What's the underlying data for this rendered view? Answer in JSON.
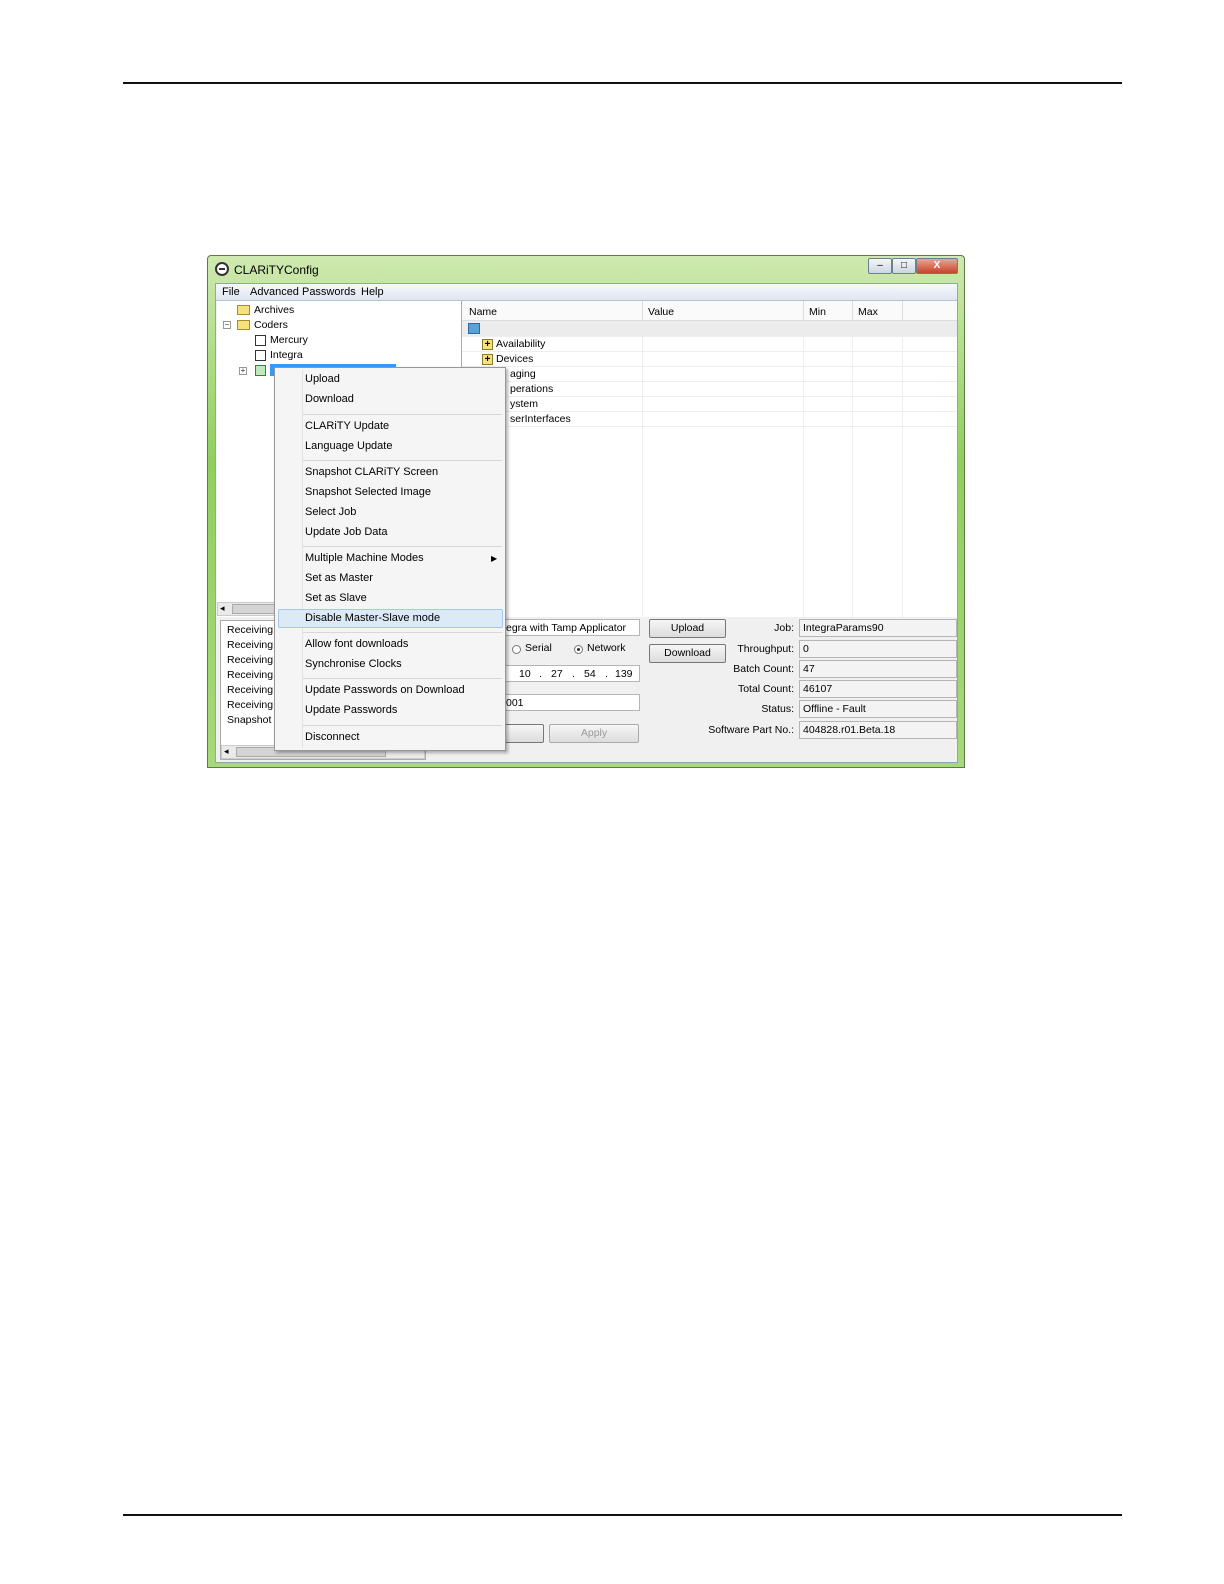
{
  "window": {
    "title": "CLARiTYConfig",
    "minimize": "–",
    "maximize": "□",
    "close": "X"
  },
  "menu": [
    "File",
    "Advanced Passwords",
    "Help"
  ],
  "tree": {
    "archives": "Archives",
    "coders": "Coders",
    "mercury": "Mercury",
    "integra": "Integra",
    "selected": "",
    "toggle_coders": "−",
    "toggle_selected": "+"
  },
  "grid": {
    "columns": [
      "Name",
      "Value",
      "Min",
      "Max"
    ],
    "items": [
      "Availability",
      "Devices",
      "aging",
      "perations",
      "ystem",
      "serInterfaces"
    ]
  },
  "log": [
    "Receiving I",
    "Receiving I",
    "Receiving I",
    "Receiving I",
    "Receiving I",
    "Receiving I",
    "Snapshot C"
  ],
  "device": {
    "name": "egra with Tamp Applicator",
    "serial_label": "Serial",
    "network_label": "Network",
    "ip": [
      "10",
      "27",
      "54",
      "139"
    ],
    "dot": ".",
    "port": "001",
    "apply": "Apply",
    "upload": "Upload",
    "download": "Download"
  },
  "status": [
    {
      "label": "Job:",
      "value": "IntegraParams90"
    },
    {
      "label": "Throughput:",
      "value": "0"
    },
    {
      "label": "Batch Count:",
      "value": "47"
    },
    {
      "label": "Total Count:",
      "value": "46107"
    },
    {
      "label": "Status:",
      "value": "Offline - Fault"
    },
    {
      "label": "Software Part No.:",
      "value": "404828.r01.Beta.18"
    }
  ],
  "context_menu": [
    "Upload",
    "Download",
    "CLARiTY Update",
    "Language Update",
    "Snapshot CLARiTY Screen",
    "Snapshot Selected Image",
    "Select Job",
    "Update Job Data",
    "Multiple Machine Modes",
    "Set as Master",
    "Set as Slave",
    "Disable Master-Slave mode",
    "Allow font downloads",
    "Synchronise Clocks",
    "Update Passwords on Download",
    "Update Passwords",
    "Disconnect"
  ],
  "context_menu_highlighted": "Disable Master-Slave mode",
  "colors": {
    "titlebar": "#8fcf5e",
    "highlight": "#dce9f7"
  }
}
